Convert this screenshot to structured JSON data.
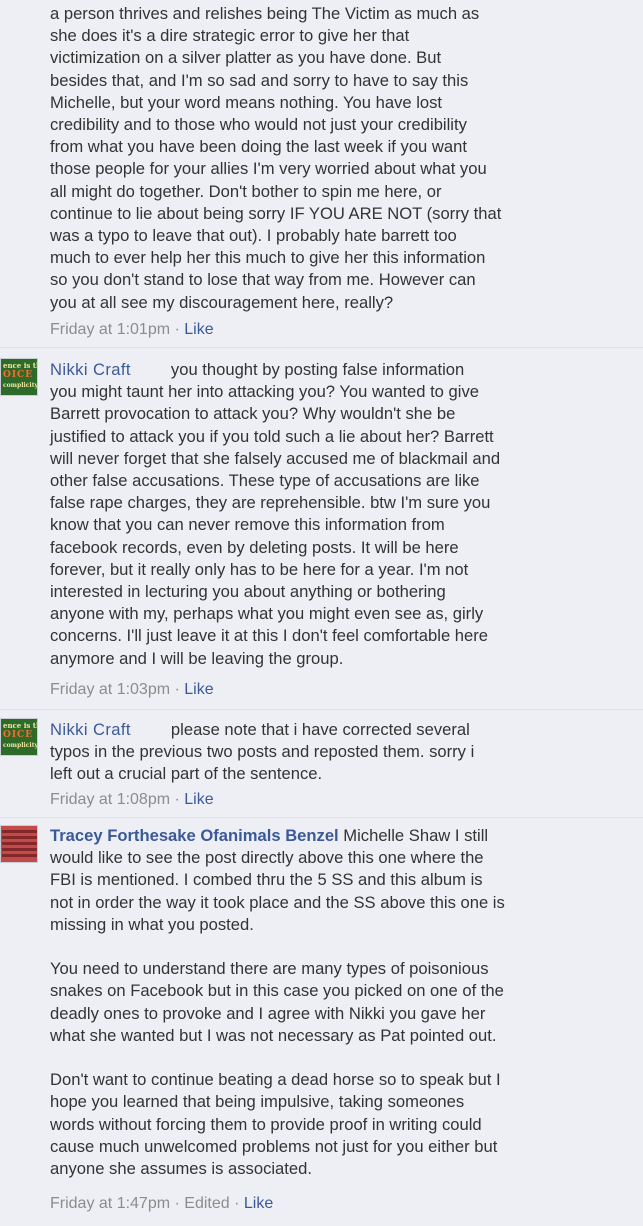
{
  "comments": [
    {
      "author": "",
      "text": "a person thrives and relishes being The Victim as much as\nshe does it's a dire strategic error to give her that\nvictimization on a silver platter as you have done. But\nbesides that, and I'm so sad and sorry to have to say this\nMichelle, but your word means nothing. You have lost\ncredibility and to those who would not just your credibility\nfrom what you have been doing the last week if you want\nthose people for your allies I'm very worried about what you\nall might do together. Don't bother to spin me here, or\ncontinue to lie about being sorry IF YOU ARE NOT (sorry that\nwas a typo to leave that out). I probably hate barrett too\nmuch to ever help her this much to give her this information\nso you don't stand to lose that way from me. However can\nyou at all see my discouragement here, really?",
      "time": "Friday at 1:01pm",
      "separator": " · ",
      "like": "Like"
    },
    {
      "author": "Nikki Craft",
      "text": "you thought by posting false information\nyou might taunt her into attacking you? You wanted to give\nBarrett provocation to attack you? Why wouldn't she be\njustified to attack you if you told such a lie about her? Barrett\nwill never forget that she falsely accused me of blackmail and\nother false accusations. These type of accusations are like\nfalse rape charges, they are reprehensible. btw I'm sure you\nknow that you can never remove this information from\nfacebook records, even by deleting posts. It will be here\nforever, but it really only has to be here for a year. I'm not\ninterested in lecturing you about anything or bothering\nanyone with my, perhaps what you might even see as, girly\nconcerns. I'll just leave it at this I don't feel comfortable here\nanymore and I will be leaving the group.",
      "time": "Friday at 1:03pm",
      "separator": " · ",
      "like": "Like",
      "avatar_text": [
        "ence is the",
        "OICE",
        "complicity."
      ]
    },
    {
      "author": "Nikki Craft",
      "text": "please note that i have corrected several\ntypos in the previous two posts and reposted them. sorry i\nleft out a crucial part of the sentence.",
      "time": "Friday at 1:08pm",
      "separator": " · ",
      "like": "Like",
      "avatar_text": [
        "ence is the",
        "OICE",
        "complicity."
      ]
    },
    {
      "author": "Tracey Forthesake Ofanimals Benzel",
      "text": " Michelle Shaw I still\nwould like to see the post directly above this one where the\nFBI is mentioned. I combed thru the 5 SS and this album is\nnot in order the way it took place and the SS above this one is\nmissing in what you posted.\n\nYou need to understand there are many types of poisonious\nsnakes on Facebook but in this case you picked on one of the\ndeadly ones to provoke and I agree with Nikki you gave her\nwhat she wanted but I was not necessary as Pat pointed out.\n\nDon't want to continue beating a dead horse so to speak but I\nhope you learned that being impulsive, taking someones\nwords without forcing them to provide proof in writing could\ncause much unwelcomed problems not just for you either but\nanyone she assumes is associated.",
      "time": "Friday at 1:47pm",
      "separator": " · ",
      "edited": "Edited",
      "like": "Like"
    }
  ],
  "colors": {
    "background": "#edeff4",
    "text": "#333333",
    "link": "#3b5998",
    "meta": "#8c8c8c"
  }
}
